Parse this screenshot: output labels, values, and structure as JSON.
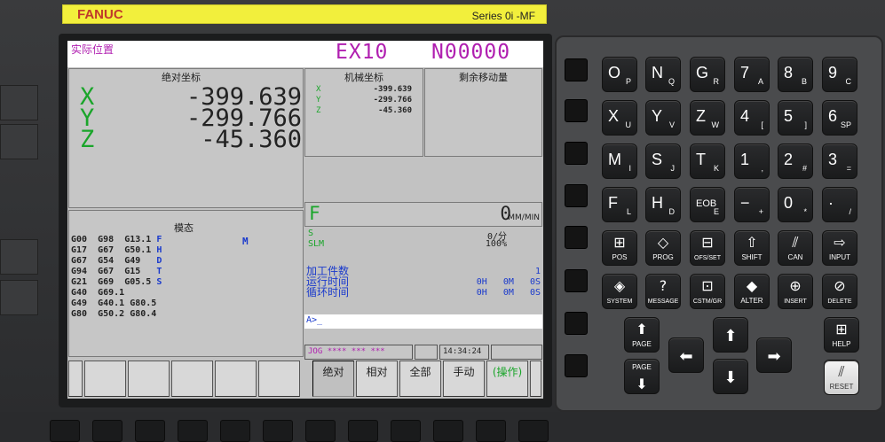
{
  "brand": {
    "left": "FANUC",
    "right": "Series 0i -MF"
  },
  "screen": {
    "title": "实际位置",
    "program": "EX10",
    "sequence": "N00000",
    "absolute": {
      "header": "绝对坐标",
      "rows": [
        {
          "axis": "X",
          "value": "-399.639"
        },
        {
          "axis": "Y",
          "value": "-299.766"
        },
        {
          "axis": "Z",
          "value": "-45.360"
        }
      ]
    },
    "machine": {
      "header": "机械坐标",
      "rows": [
        {
          "axis": "X",
          "value": "-399.639"
        },
        {
          "axis": "Y",
          "value": "-299.766"
        },
        {
          "axis": "Z",
          "value": "-45.360"
        }
      ]
    },
    "remaining": {
      "header": "剩余移动量"
    },
    "modal": {
      "header": "模态",
      "lines": [
        "G00  G98  G13.1",
        "G17  G67  G50.1",
        "G67  G54  G49",
        "G94  G67  G15",
        "G21  G69  G05.5",
        "G40  G69.1",
        "G49  G40.1 G80.5",
        "G80  G50.2 G80.4"
      ],
      "letters": [
        "F",
        "H",
        "D",
        "T",
        "S"
      ],
      "m": "M"
    },
    "feed": {
      "label": "F",
      "value": "0",
      "unit": "MM/MIN"
    },
    "spindle": {
      "s_label": "S",
      "s_value": "0/分",
      "slm_label": "SLM",
      "slm_value": "100%"
    },
    "counters": [
      {
        "label": "加工件数",
        "value": "1"
      },
      {
        "label": "运行时间",
        "value": "0H   0M   0S"
      },
      {
        "label": "循环时间",
        "value": "0H   0M   0S"
      }
    ],
    "command_prompt": "A>_",
    "status": {
      "mode": "JOG",
      "stars": "**** *** ***",
      "time": "14:34:24"
    },
    "softkeys": [
      "绝对",
      "相对",
      "全部",
      "手动",
      "(操作)"
    ]
  },
  "keypad": {
    "rows": [
      [
        {
          "m": "O",
          "s": "P"
        },
        {
          "m": "N",
          "s": "Q"
        },
        {
          "m": "G",
          "s": "R"
        },
        {
          "m": "7",
          "s": "A"
        },
        {
          "m": "8",
          "s": "B"
        },
        {
          "m": "9",
          "s": "C"
        }
      ],
      [
        {
          "m": "X",
          "s": "U"
        },
        {
          "m": "Y",
          "s": "V"
        },
        {
          "m": "Z",
          "s": "W"
        },
        {
          "m": "4",
          "s": "["
        },
        {
          "m": "5",
          "s": "]"
        },
        {
          "m": "6",
          "s": "SP"
        }
      ],
      [
        {
          "m": "M",
          "s": "I"
        },
        {
          "m": "S",
          "s": "J"
        },
        {
          "m": "T",
          "s": "K"
        },
        {
          "m": "1",
          "s": ","
        },
        {
          "m": "2",
          "s": "#"
        },
        {
          "m": "3",
          "s": "="
        }
      ],
      [
        {
          "m": "F",
          "s": "L"
        },
        {
          "m": "H",
          "s": "D"
        },
        {
          "m": "EOB",
          "s": "E"
        },
        {
          "m": "−",
          "s": "+"
        },
        {
          "m": "0",
          "s": "*"
        },
        {
          "m": "·",
          "s": "/"
        }
      ]
    ],
    "func_row1": [
      "POS",
      "PROG",
      "OFS/SET",
      "SHIFT",
      "CAN",
      "INPUT"
    ],
    "func_row2": [
      "SYSTEM",
      "MESSAGE",
      "CSTM/GR",
      "ALTER",
      "INSERT",
      "DELETE"
    ],
    "page_up": "PAGE",
    "page_down": "PAGE",
    "help": "HELP",
    "reset": "RESET"
  }
}
